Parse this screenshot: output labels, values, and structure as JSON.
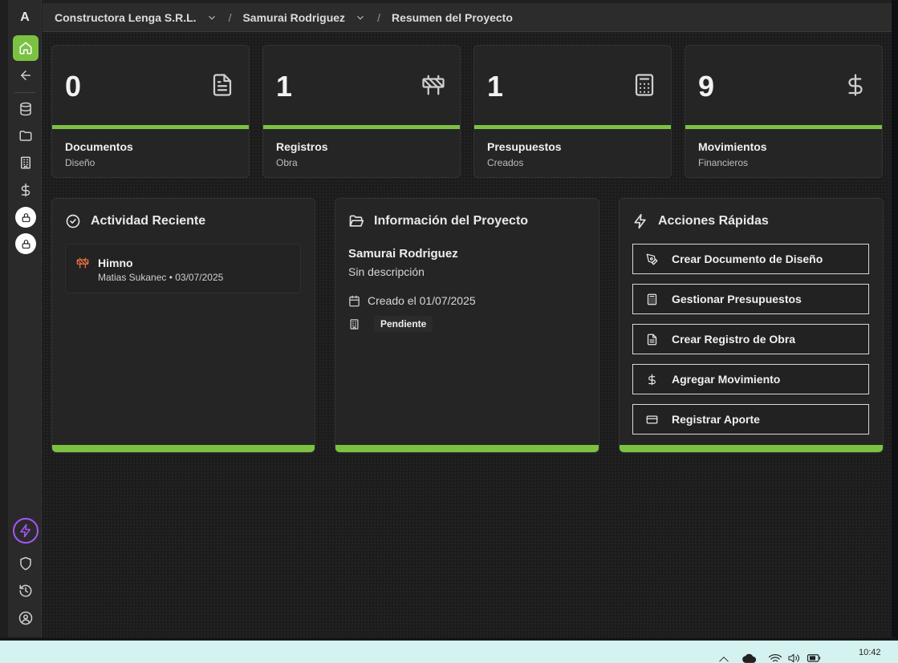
{
  "sidebar": {
    "logo": "A",
    "items": [
      {
        "name": "home",
        "icon": "home-icon"
      },
      {
        "name": "back",
        "icon": "arrow-left-icon"
      },
      {
        "name": "database",
        "icon": "database-icon"
      },
      {
        "name": "folder",
        "icon": "folder-icon"
      },
      {
        "name": "building",
        "icon": "building-icon"
      },
      {
        "name": "dollar",
        "icon": "dollar-icon"
      },
      {
        "name": "locked-1",
        "icon": "lock-icon"
      },
      {
        "name": "locked-2",
        "icon": "lock-icon"
      },
      {
        "name": "quick",
        "icon": "bolt-icon"
      },
      {
        "name": "security",
        "icon": "shield-icon"
      },
      {
        "name": "history",
        "icon": "history-icon"
      },
      {
        "name": "profile",
        "icon": "user-circle-icon"
      }
    ]
  },
  "header": {
    "org": "Constructora Lenga S.R.L.",
    "project": "Samurai Rodriguez",
    "page": "Resumen del Proyecto",
    "separator": "/"
  },
  "stats": [
    {
      "value": "0",
      "label": "Documentos",
      "sub": "Diseño",
      "icon": "file-text-icon"
    },
    {
      "value": "1",
      "label": "Registros",
      "sub": "Obra",
      "icon": "construction-icon"
    },
    {
      "value": "1",
      "label": "Presupuestos",
      "sub": "Creados",
      "icon": "calculator-icon"
    },
    {
      "value": "9",
      "label": "Movimientos",
      "sub": "Financieros",
      "icon": "dollar-icon"
    }
  ],
  "activity": {
    "title": "Actividad Reciente",
    "items": [
      {
        "title": "Himno",
        "meta": "Matias Sukanec • 03/07/2025",
        "icon": "construction-icon"
      }
    ]
  },
  "info": {
    "title": "Información del Proyecto",
    "name": "Samurai Rodriguez",
    "description": "Sin descripción",
    "created": "Creado el 01/07/2025",
    "status": "Pendiente"
  },
  "quick_actions": {
    "title": "Acciones Rápidas",
    "buttons": [
      {
        "label": "Crear Documento de Diseño",
        "icon": "pen-tool-icon"
      },
      {
        "label": "Gestionar Presupuestos",
        "icon": "calculator-icon"
      },
      {
        "label": "Crear Registro de Obra",
        "icon": "file-text-icon"
      },
      {
        "label": "Agregar Movimiento",
        "icon": "dollar-icon"
      },
      {
        "label": "Registrar Aporte",
        "icon": "credit-card-icon"
      }
    ]
  },
  "taskbar": {
    "time": "10:42"
  },
  "colors": {
    "accent": "#7cc242",
    "bolt": "#a855f7",
    "activity_icon": "#e0703a"
  }
}
